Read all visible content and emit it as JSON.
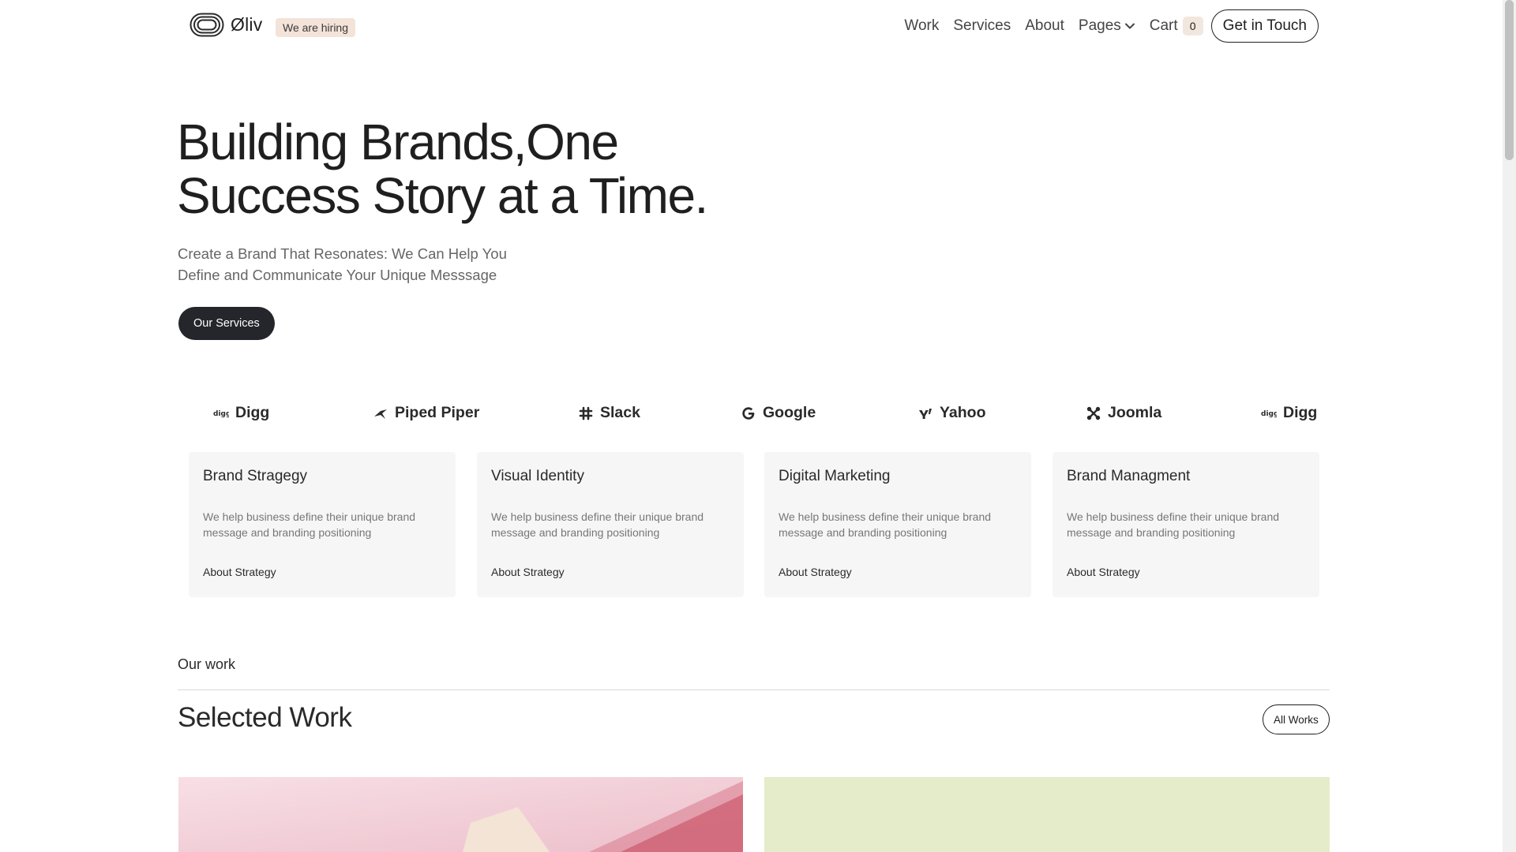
{
  "header": {
    "logo_text": "Øliv",
    "hiring_badge": "We are hiring",
    "nav": {
      "work": "Work",
      "services": "Services",
      "about": "About",
      "pages": "Pages",
      "cart": "Cart",
      "cart_count": "0",
      "cta": "Get in Touch"
    }
  },
  "hero": {
    "title_line1": "Building Brands,One",
    "title_line2": "Success Story at a Time.",
    "subtitle_line1": "Create a Brand That Resonates: We Can Help You",
    "subtitle_line2": "Define and Communicate Your Unique Messsage",
    "button": "Our Services"
  },
  "logos": [
    {
      "name": "Digg",
      "icon": "digg-icon"
    },
    {
      "name": "Piped Piper",
      "icon": "pied-piper-icon"
    },
    {
      "name": "Slack",
      "icon": "slack-icon"
    },
    {
      "name": "Google",
      "icon": "google-icon"
    },
    {
      "name": "Yahoo",
      "icon": "yahoo-icon"
    },
    {
      "name": "Joomla",
      "icon": "joomla-icon"
    },
    {
      "name": "Digg",
      "icon": "digg-icon"
    }
  ],
  "services": [
    {
      "title": "Brand Stragegy",
      "desc": "We help business define their unique brand message and branding positioning",
      "link": "About Strategy"
    },
    {
      "title": "Visual Identity",
      "desc": "We help business define their unique brand message and branding positioning",
      "link": "About Strategy"
    },
    {
      "title": "Digital Marketing",
      "desc": "We help business define their unique brand message and branding positioning",
      "link": "About Strategy"
    },
    {
      "title": "Brand Managment",
      "desc": "We help business define their unique brand message and branding positioning",
      "link": "About Strategy"
    }
  ],
  "work": {
    "label": "Our work",
    "title": "Selected Work",
    "all_button": "All Works"
  },
  "colors": {
    "dark_button": "#24262b",
    "badge_bg": "#f3e3d9",
    "card_bg": "#f6f6f6",
    "work_pink": "#efc6d0",
    "work_green": "#e4ecca"
  }
}
